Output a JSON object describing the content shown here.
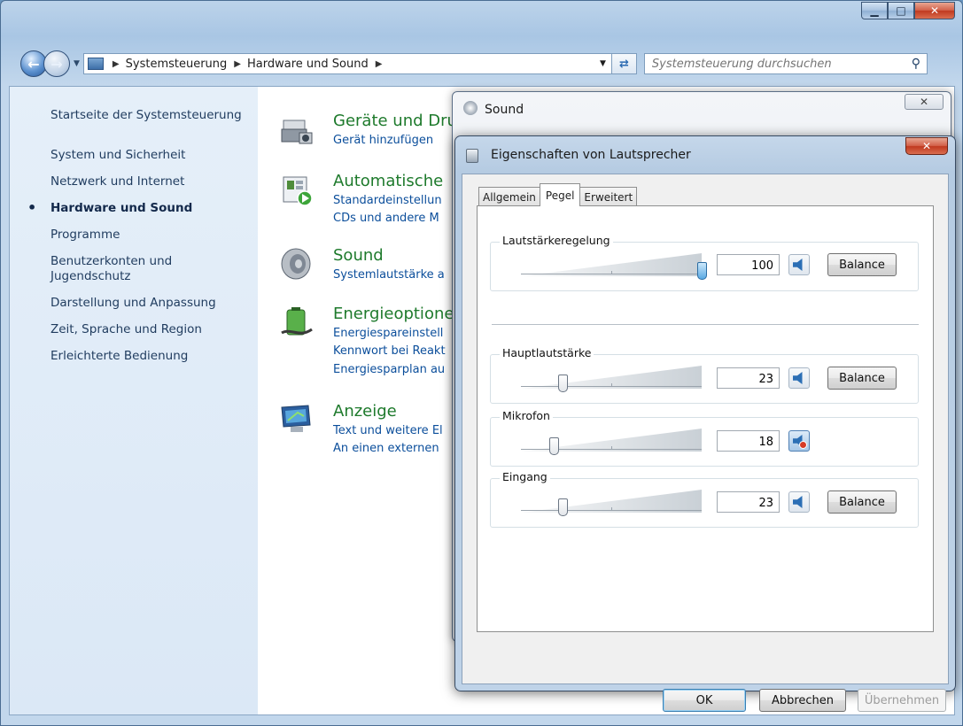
{
  "explorer": {
    "breadcrumbs": [
      "Systemsteuerung",
      "Hardware und Sound"
    ],
    "search_placeholder": "Systemsteuerung durchsuchen"
  },
  "sidebar": {
    "items": [
      {
        "label": "Startseite der Systemsteuerung"
      },
      {
        "label": "System und Sicherheit"
      },
      {
        "label": "Netzwerk und Internet"
      },
      {
        "label": "Hardware und Sound",
        "active": true
      },
      {
        "label": "Programme"
      },
      {
        "label": "Benutzerkonten und\nJugendschutz"
      },
      {
        "label": "Darstellung und Anpassung"
      },
      {
        "label": "Zeit, Sprache und Region"
      },
      {
        "label": "Erleichterte Bedienung"
      }
    ]
  },
  "categories": [
    {
      "title": "Geräte und Dru",
      "icon": "printer-camera-icon",
      "links": [
        "Gerät hinzufügen"
      ]
    },
    {
      "title": "Automatische",
      "icon": "autoplay-icon",
      "links": [
        "Standardeinstellun",
        "CDs und andere M"
      ]
    },
    {
      "title": "Sound",
      "icon": "speaker-icon",
      "links": [
        "Systemlautstärke a"
      ]
    },
    {
      "title": "Energieoptione",
      "icon": "battery-icon",
      "links": [
        "Energiespareinstell",
        "Kennwort bei Reakt",
        "Energiesparplan au"
      ]
    },
    {
      "title": "Anzeige",
      "icon": "monitor-icon",
      "links": [
        "Text und weitere El",
        "An einen externen"
      ]
    }
  ],
  "sound_dialog": {
    "title": "Sound"
  },
  "properties": {
    "title": "Eigenschaften von Lautsprecher",
    "tabs": [
      "Allgemein",
      "Pegel",
      "Erweitert"
    ],
    "active_tab": "Pegel",
    "levels": [
      {
        "label": "Lautstärkeregelung",
        "value": 100,
        "balance": "Balance",
        "muted": false
      },
      {
        "label": "Hauptlautstärke",
        "value": 23,
        "balance": "Balance",
        "muted": false
      },
      {
        "label": "Mikrofon",
        "value": 18,
        "muted": true
      },
      {
        "label": "Eingang",
        "value": 23,
        "balance": "Balance",
        "muted": false
      }
    ],
    "buttons": {
      "ok": "OK",
      "cancel": "Abbrechen",
      "apply": "Übernehmen"
    }
  }
}
